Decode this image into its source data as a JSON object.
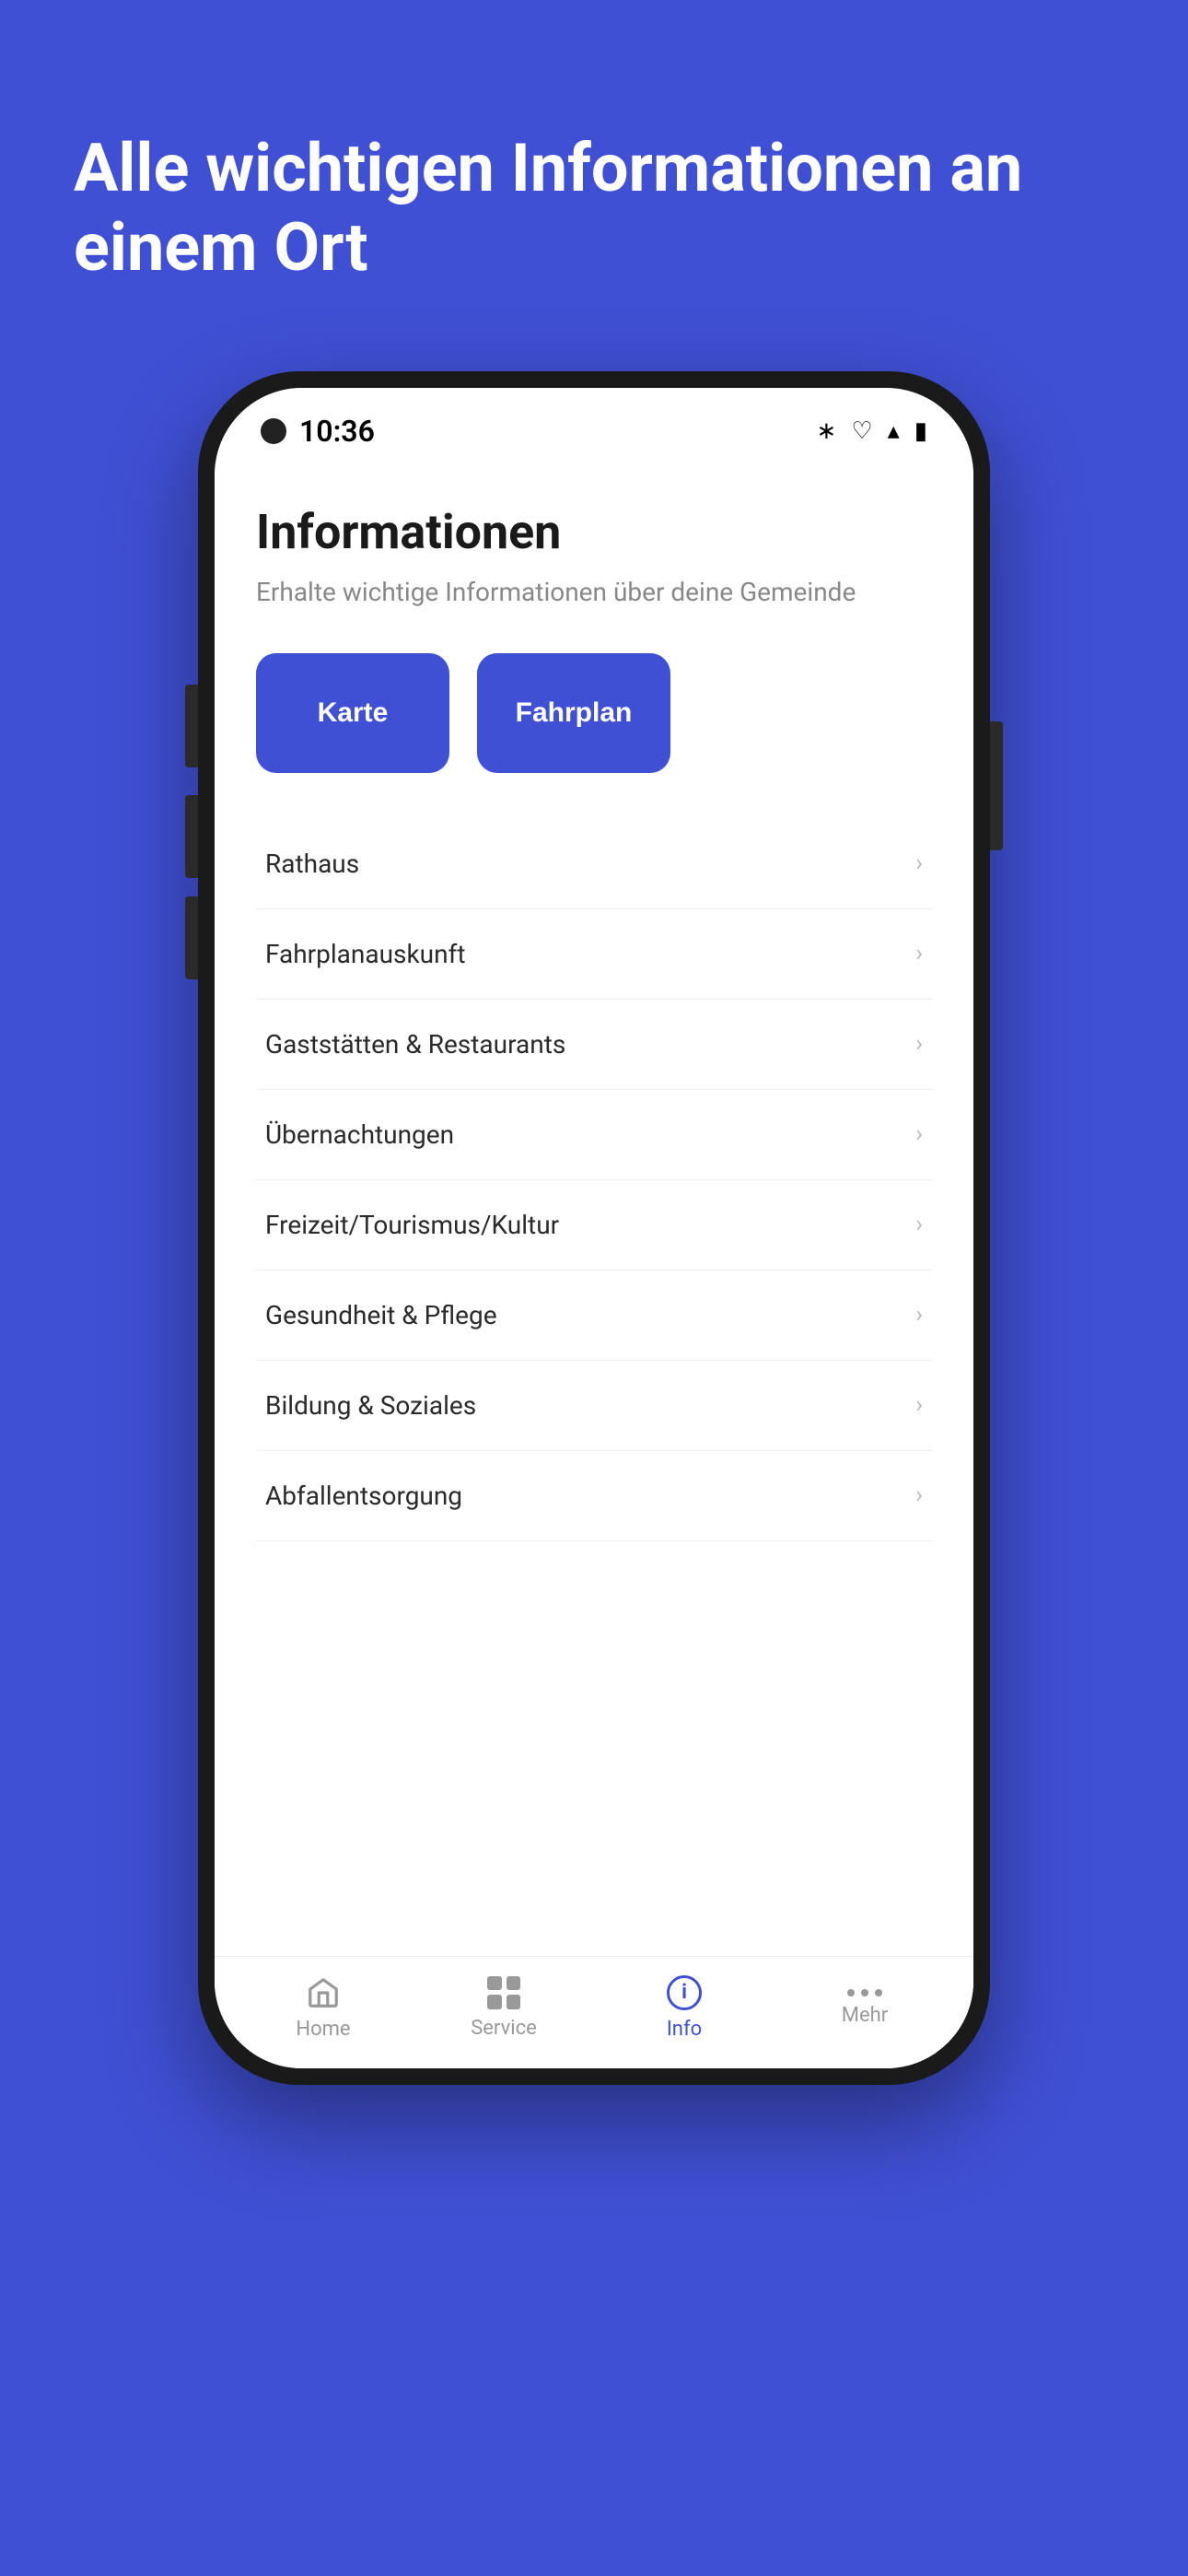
{
  "background_color": "#4050d4",
  "hero": {
    "title": "Alle wichtigen Informationen an einem Ort"
  },
  "phone": {
    "status_bar": {
      "time": "10:36"
    },
    "app": {
      "title": "Informationen",
      "subtitle": "Erhalte wichtige Informationen über deine Gemeinde",
      "buttons": [
        {
          "id": "karte",
          "label": "Karte"
        },
        {
          "id": "fahrplan",
          "label": "Fahrplan"
        }
      ],
      "menu_items": [
        {
          "id": "rathaus",
          "label": "Rathaus"
        },
        {
          "id": "fahrplanauskunft",
          "label": "Fahrplanauskunft"
        },
        {
          "id": "gaststaetten",
          "label": "Gaststätten & Restaurants"
        },
        {
          "id": "uebernachtungen",
          "label": "Übernachtungen"
        },
        {
          "id": "freizeit",
          "label": "Freizeit/Tourismus/Kultur"
        },
        {
          "id": "gesundheit",
          "label": "Gesundheit & Pflege"
        },
        {
          "id": "bildung",
          "label": "Bildung & Soziales"
        },
        {
          "id": "abfall",
          "label": "Abfallentsorgung"
        }
      ]
    },
    "bottom_nav": {
      "items": [
        {
          "id": "home",
          "label": "Home",
          "icon": "home",
          "active": false
        },
        {
          "id": "service",
          "label": "Service",
          "icon": "grid",
          "active": false
        },
        {
          "id": "info",
          "label": "Info",
          "icon": "info",
          "active": true
        },
        {
          "id": "mehr",
          "label": "Mehr",
          "icon": "dots",
          "active": false
        }
      ]
    }
  }
}
